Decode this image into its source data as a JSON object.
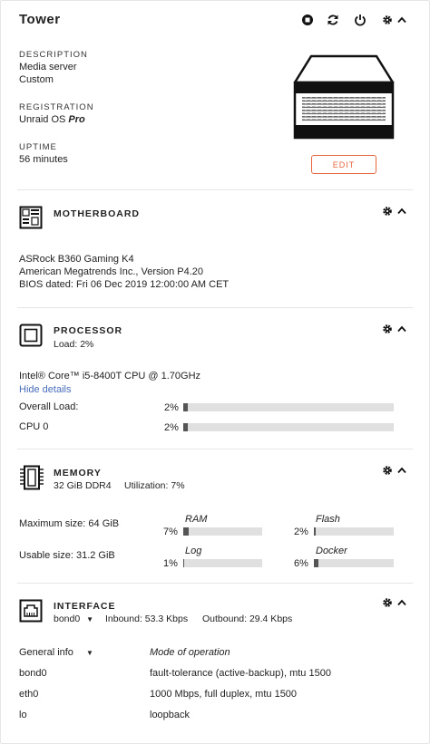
{
  "server": {
    "name": "Tower",
    "description_label": "DESCRIPTION",
    "description_line1": "Media server",
    "description_line2": "Custom",
    "registration_label": "REGISTRATION",
    "registration_value": "Unraid OS",
    "registration_tier": "Pro",
    "uptime_label": "UPTIME",
    "uptime_value": "56 minutes",
    "edit_label": "EDIT",
    "accent_color": "#e8663e"
  },
  "motherboard": {
    "title": "MOTHERBOARD",
    "model": "ASRock B360 Gaming K4",
    "bios_vendor": "American Megatrends Inc., Version P4.20",
    "bios_date": "BIOS dated: Fri 06 Dec 2019 12:00:00 AM CET"
  },
  "processor": {
    "title": "PROCESSOR",
    "load": "Load: 2%",
    "cpu_model": "Intel® Core™ i5-8400T CPU @ 1.70GHz",
    "hide_details": "Hide details",
    "overall_label": "Overall Load:",
    "overall_value": "2%",
    "overall_fraction": 0.02,
    "cpu0_label": "CPU 0",
    "cpu0_value": "2%",
    "cpu0_fraction": 0.02
  },
  "memory": {
    "title": "MEMORY",
    "summary": "32 GiB DDR4",
    "utilization": "Utilization: 7%",
    "max_size": "Maximum size: 64 GiB",
    "usable_size": "Usable size: 31.2 GiB",
    "ram_label": "RAM",
    "ram_value": "7%",
    "ram_fraction": 0.07,
    "flash_label": "Flash",
    "flash_value": "2%",
    "flash_fraction": 0.02,
    "log_label": "Log",
    "log_value": "1%",
    "log_fraction": 0.01,
    "docker_label": "Docker",
    "docker_value": "6%",
    "docker_fraction": 0.06
  },
  "interface": {
    "title": "INTERFACE",
    "selected": "bond0",
    "inbound": "Inbound: 53.3 Kbps",
    "outbound": "Outbound: 29.4 Kbps",
    "info_select": "General info",
    "mode_header": "Mode of operation",
    "rows": [
      {
        "name": "bond0",
        "mode": "fault-tolerance (active-backup), mtu 1500"
      },
      {
        "name": "eth0",
        "mode": "1000 Mbps, full duplex, mtu 1500"
      },
      {
        "name": "lo",
        "mode": "loopback"
      }
    ]
  },
  "icons": [
    "stop-icon",
    "restart-icon",
    "power-icon",
    "gear-icon",
    "chevron-up-icon",
    "motherboard-icon",
    "processor-icon",
    "memory-icon",
    "network-icon",
    "server-image"
  ]
}
